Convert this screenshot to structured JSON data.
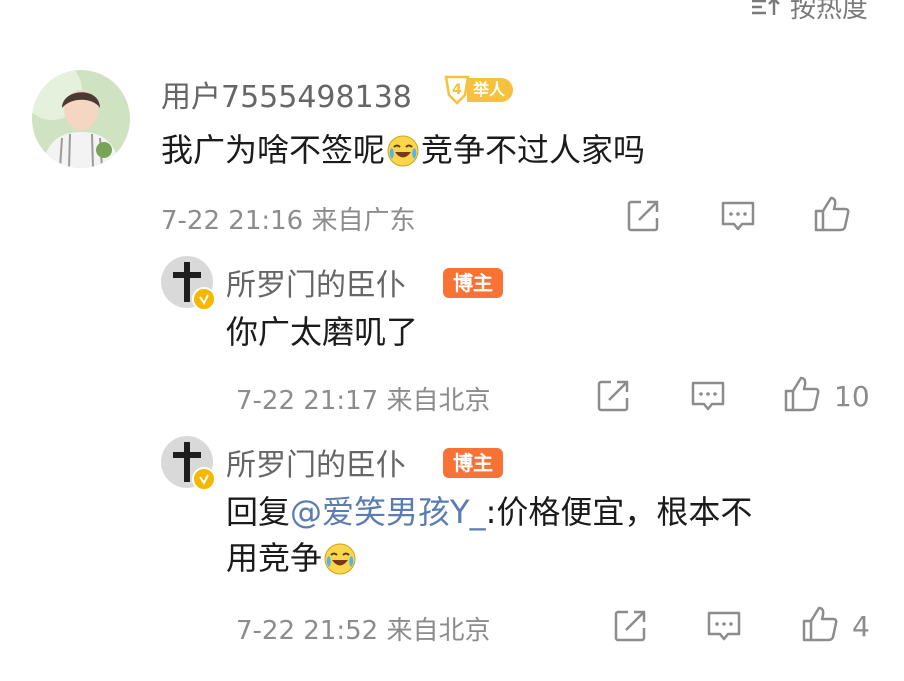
{
  "sort": {
    "label": "按热度",
    "icon": "sort-icon"
  },
  "comments": [
    {
      "username": "用户7555498138",
      "fan_badge": {
        "level": "4",
        "label": "举人"
      },
      "text_before_emoji": "我广为啥不签呢",
      "text_after_emoji": "竞争不过人家吗",
      "emoji": "laugh-cry-emoji",
      "meta": "7-22 21:16 来自广东",
      "like_count": ""
    },
    {
      "username": "所罗门的臣仆",
      "badge": "博主",
      "text": "你广太磨叽了",
      "meta": "7-22 21:17 来自北京",
      "like_count": "10"
    },
    {
      "username": "所罗门的臣仆",
      "badge": "博主",
      "text_prefix": "回复",
      "mention": "@爱笑男孩Y_",
      "text_line1_rest": ":价格便宜，根本不",
      "text_line2": "用竞争",
      "emoji": "laugh-cry-emoji",
      "meta": "7-22 21:52 来自北京",
      "like_count": "4"
    }
  ],
  "colors": {
    "username": "#666666",
    "meta": "#8c8c8c",
    "mention": "#5b7cb0",
    "blogger_badge": "#f77234",
    "fan_badge": "#f6c23e",
    "verified": "#f5b700"
  }
}
